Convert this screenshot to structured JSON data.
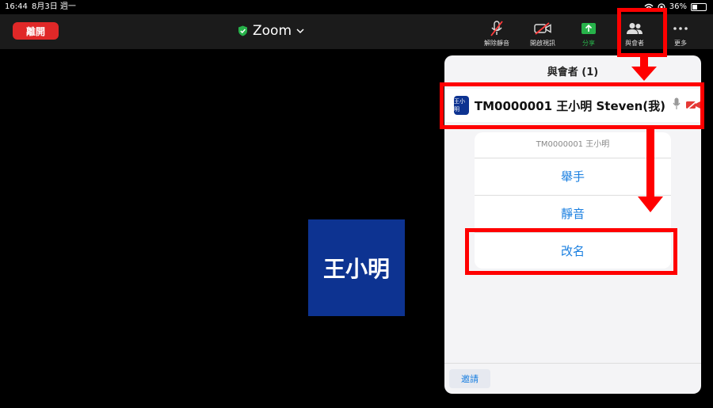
{
  "status": {
    "time": "16:44",
    "date": "8月3日 週一",
    "battery": "36%"
  },
  "toolbar": {
    "leave_label": "離開",
    "meeting_title": "Zoom",
    "tools": [
      {
        "name": "unmute",
        "label": "解除靜音",
        "icon": "mic-off-icon"
      },
      {
        "name": "start-video",
        "label": "開啟視訊",
        "icon": "video-off-icon"
      },
      {
        "name": "share",
        "label": "分享",
        "icon": "share-icon"
      },
      {
        "name": "participants",
        "label": "與會者",
        "icon": "participants-icon"
      },
      {
        "name": "more",
        "label": "更多",
        "icon": "more-icon"
      }
    ]
  },
  "video": {
    "display_name": "王小明"
  },
  "panel": {
    "title": "與會者 (1)",
    "participant": {
      "avatar_text": "王小明",
      "name": "TM0000001 王小明 Steven(我)"
    },
    "menu": {
      "header": "TM0000001 王小明",
      "items": [
        "舉手",
        "靜音",
        "改名"
      ]
    },
    "invite_label": "邀請"
  },
  "colors": {
    "leave": "#e02828",
    "share": "#27b24a",
    "link": "#1a7fe0",
    "avatar": "#0d3391",
    "annotation": "#ff0000"
  }
}
